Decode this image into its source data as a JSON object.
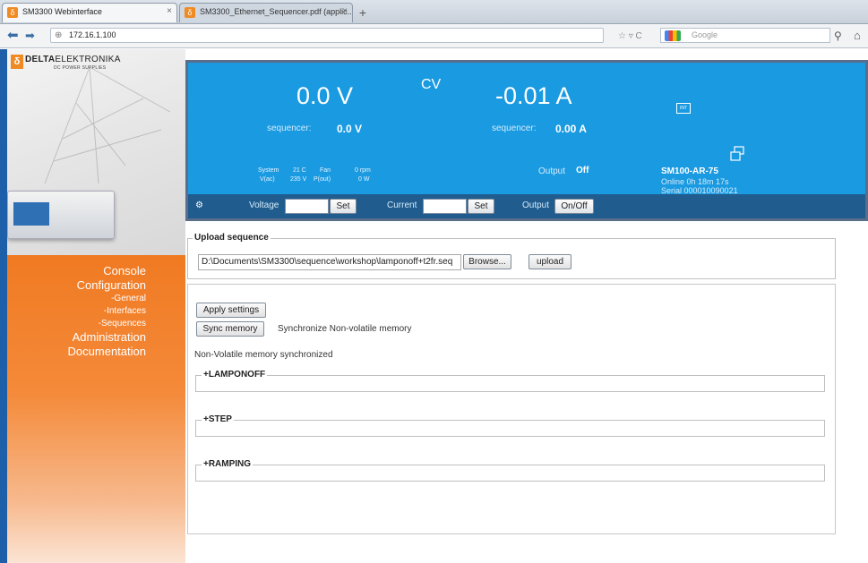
{
  "browser": {
    "tabs": [
      {
        "label": "SM3300 Webinterface",
        "close": "×"
      },
      {
        "label": "SM3300_Ethernet_Sequencer.pdf (applic...",
        "close": "×"
      }
    ],
    "new_tab": "+",
    "url": "172.16.1.100",
    "search_placeholder": "Google"
  },
  "logo": {
    "brand_bold": "DELTA",
    "brand_light": "ELEKTRONIKA",
    "sub": "DC POWER SUPPLIES"
  },
  "menu": {
    "console": "Console",
    "configuration": "Configuration",
    "general": "-General",
    "interfaces": "-Interfaces",
    "sequences": "-Sequences",
    "administration": "Administration",
    "documentation": "Documentation"
  },
  "status": {
    "voltage": "0.0 V",
    "mode": "CV",
    "current": "-0.01 A",
    "seq_label_v": "sequencer:",
    "seq_voltage": "0.0 V",
    "seq_label_a": "sequencer:",
    "seq_current": "0.00 A",
    "system_label": "System",
    "system_temp": "21 C",
    "fan_label": "Fan",
    "fan_value": "0 rpm",
    "vac_label": "V(ac)",
    "vac_value": "235 V",
    "pout_label": "P(out)",
    "pout_value": "0 W",
    "output_label": "Output",
    "output_value": "Off",
    "int_icon": "INT",
    "model": "SM100-AR-75",
    "online": "Online  0h 18m 17s",
    "serial": "Serial  000010090021",
    "voltage_field_label": "Voltage",
    "set_label": "Set",
    "current_field_label": "Current",
    "set_label_2": "Set",
    "output_field_label": "Output",
    "onoff_label": "On/Off"
  },
  "upload": {
    "legend": "Upload sequence",
    "path": "D:\\Documents\\SM3300\\sequence\\workshop\\lamponoff+t2fr.seq",
    "browse": "Browse...",
    "upload": "upload"
  },
  "sequences": {
    "apply": "Apply settings",
    "sync": "Sync memory",
    "sync_desc": "Synchronize Non-volatile memory",
    "status_msg": "Non-Volatile memory synchronized",
    "items": [
      "+LAMPONOFF",
      "+STEP",
      "+RAMPING"
    ]
  }
}
